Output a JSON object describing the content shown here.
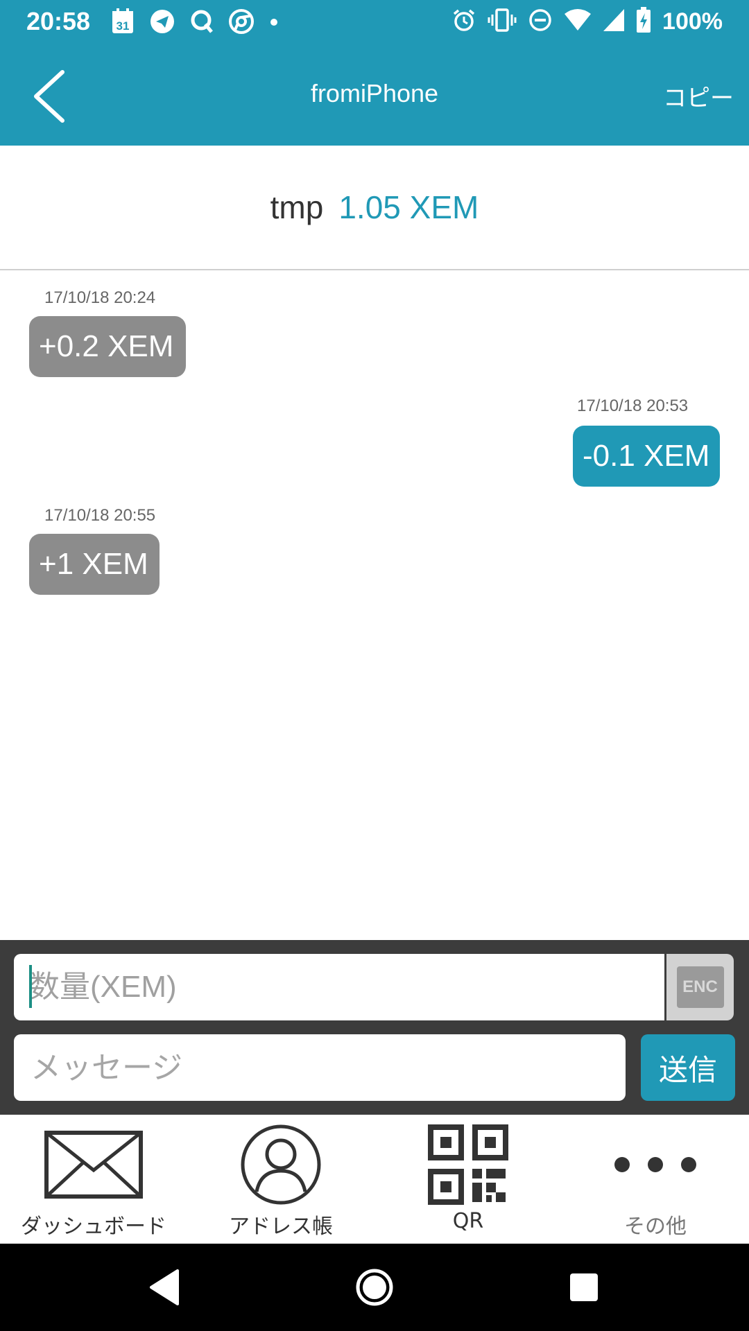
{
  "status_bar": {
    "time": "20:58",
    "left_icons": [
      "calendar-icon",
      "telegram-icon",
      "search-q-icon",
      "chrome-icon",
      "dot-icon"
    ],
    "calendar_day": "31",
    "right_icons": [
      "alarm-icon",
      "vibrate-icon",
      "dnd-icon",
      "wifi-icon",
      "signal-icon",
      "battery-charging-icon"
    ],
    "battery": "100%"
  },
  "app_bar": {
    "title": "fromiPhone",
    "copy_label": "コピー"
  },
  "balance": {
    "name": "tmp",
    "amount": "1.05 XEM"
  },
  "messages": [
    {
      "timestamp": "17/10/18 20:24",
      "amount": "+0.2 XEM",
      "direction": "incoming"
    },
    {
      "timestamp": "17/10/18 20:53",
      "amount": "-0.1 XEM",
      "direction": "outgoing"
    },
    {
      "timestamp": "17/10/18 20:55",
      "amount": "+1 XEM",
      "direction": "incoming"
    }
  ],
  "input": {
    "amount_placeholder": "数量(XEM)",
    "enc_label": "ENC",
    "message_placeholder": "メッセージ",
    "send_label": "送信"
  },
  "bottom_nav": [
    {
      "label": "ダッシュボード",
      "icon": "envelope-icon"
    },
    {
      "label": "アドレス帳",
      "icon": "person-icon"
    },
    {
      "label": "QR",
      "icon": "qr-code-icon"
    },
    {
      "label": "その他",
      "icon": "more-dots-icon"
    }
  ],
  "colors": {
    "accent": "#2099b6",
    "incoming_bubble": "#8c8c8c",
    "input_bar": "#3c3c3c"
  }
}
